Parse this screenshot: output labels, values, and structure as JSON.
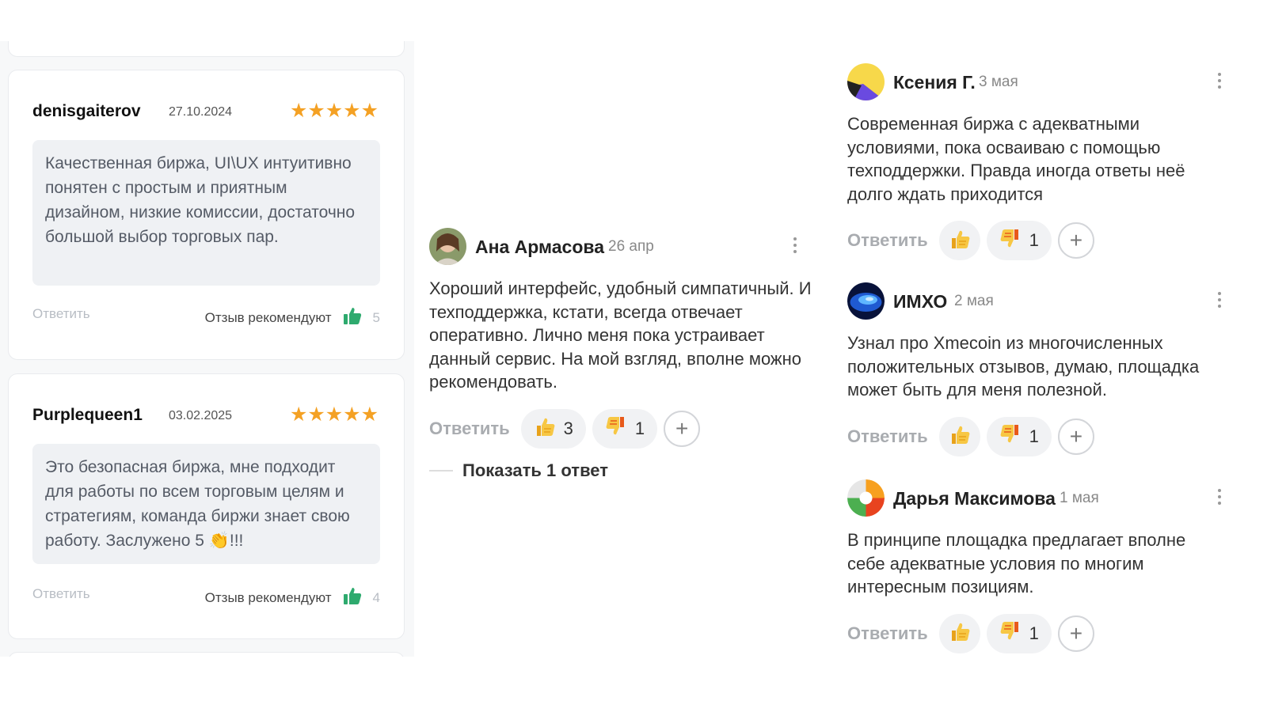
{
  "left_reviews": [
    {
      "author": "denisgaiterov",
      "date": "27.10.2024",
      "stars": "★★★★★",
      "text": "Качественная биржа, UI\\UX интуитивно понятен с простым и приятным дизайном, низкие комиссии, достаточно большой выбор торговых пар.",
      "reply_label": "Ответить",
      "recommend_label": "Отзыв рекомендуют",
      "recommend_count": "5"
    },
    {
      "author": "Purplequeen1",
      "date": "03.02.2025",
      "stars": "★★★★★",
      "text": "Это безопасная биржа, мне подходит для работы по всем торговым целям и стратегиям, команда биржи знает свою работу. Заслужено 5 👏!!!",
      "reply_label": "Ответить",
      "recommend_label": "Отзыв рекомендуют",
      "recommend_count": "4"
    }
  ],
  "comments": [
    {
      "name": "Ана Армасова",
      "date": "26 апр",
      "text": "Хороший интерфейс, удобный симпатичный. И техподдержка, кстати, всегда отвечает оперативно. Лично меня пока устраивает данный сервис. На мой взгляд, вполне можно рекомендовать.",
      "reply_label": "Ответить",
      "likes": "3",
      "dislikes": "1",
      "show_replies": "Показать 1 ответ"
    },
    {
      "name": "Ксения Г.",
      "date": "3 мая",
      "text": "Современная биржа с адекватными условиями, пока осваиваю с помощью техподдержки. Правда иногда ответы неё долго ждать приходится",
      "reply_label": "Ответить",
      "dislikes": "1"
    },
    {
      "name": "ИМХО",
      "date": "2 мая",
      "text": "Узнал про Xmecoin из многочисленных положительных отзывов, думаю, площадка может быть для меня полезной.",
      "reply_label": "Ответить",
      "dislikes": "1"
    },
    {
      "name": "Дарья Максимова",
      "date": "1 мая",
      "text": "В принципе площадка предлагает вполне себе адекватные условия по многим интересным позициям.",
      "reply_label": "Ответить",
      "dislikes": "1"
    }
  ],
  "icons": {
    "star_color": "#f4a124",
    "thumb_color": "#2eaa6e",
    "emoji_like": "like-emoji-icon",
    "emoji_dislike": "dislike-emoji-icon",
    "plus": "+"
  }
}
